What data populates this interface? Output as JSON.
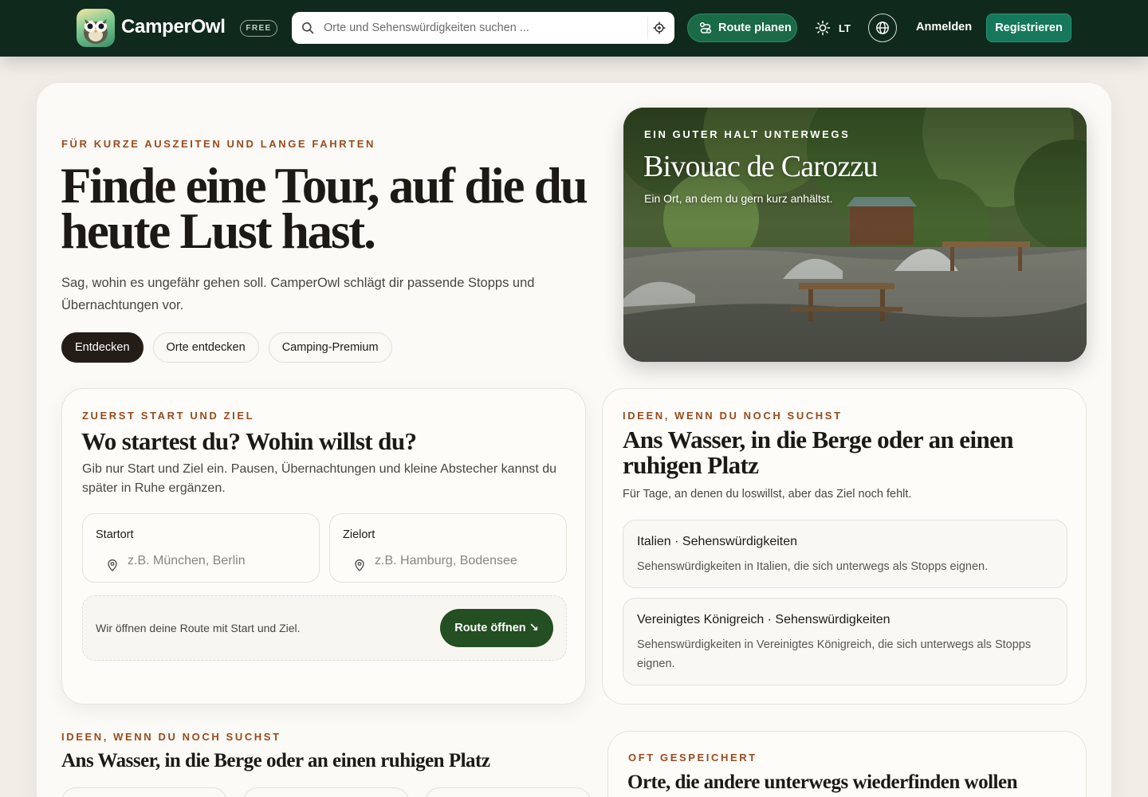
{
  "header": {
    "brand": "CamperOwl",
    "badge": "FREE",
    "search_placeholder": "Orte und Sehenswürdigkeiten suchen ...",
    "route_button": "Route planen",
    "theme_label": "LT",
    "login": "Anmelden",
    "register": "Registrieren",
    "icons": [
      "owl-logo",
      "search-icon",
      "locate-icon",
      "route-icon",
      "sun-icon",
      "globe-icon"
    ]
  },
  "hero": {
    "eyebrow": "FÜR KURZE AUSZEITEN UND LANGE FAHRTEN",
    "title": "Finde eine Tour, auf die du heute Lust hast.",
    "subtitle": "Sag, wohin es ungefähr gehen soll. CamperOwl schlägt dir passende Stopps und Übernachtungen vor.",
    "tabs": [
      {
        "label": "Entdecken",
        "active": true
      },
      {
        "label": "Orte entdecken",
        "active": false
      },
      {
        "label": "Camping-Premium",
        "active": false
      }
    ]
  },
  "featured": {
    "eyebrow": "EIN GUTER HALT UNTERWEGS",
    "title": "Bivouac de Carozzu",
    "subtitle": "Ein Ort, an dem du gern kurz anhältst."
  },
  "route_planner": {
    "eyebrow": "ZUERST START UND ZIEL",
    "title": "Wo startest du? Wohin willst du?",
    "subtitle": "Gib nur Start und Ziel ein. Pausen, Übernachtungen und kleine Abstecher kannst du später in Ruhe ergänzen.",
    "start_label": "Startort",
    "start_placeholder": "z.B. München, Berlin",
    "end_label": "Zielort",
    "end_placeholder": "z.B. Hamburg, Bodensee",
    "note": "Wir öffnen deine Route mit Start und Ziel.",
    "submit": "Route öffnen",
    "submit_icon": "↘"
  },
  "ideas": {
    "eyebrow": "IDEEN, WENN DU NOCH SUCHST",
    "title": "Ans Wasser, in die Berge oder an einen ruhigen Platz",
    "subtitle": "Für Tage, an denen du loswillst, aber das Ziel noch fehlt.",
    "items": [
      {
        "title": "Italien · Sehenswürdigkeiten",
        "desc": "Sehenswürdigkeiten in Italien, die sich unterwegs als Stopps eignen."
      },
      {
        "title": "Vereinigtes Königreich · Sehenswürdigkeiten",
        "desc": "Sehenswürdigkeiten in Vereinigtes Königreich, die sich unterwegs als Stopps eignen."
      }
    ]
  },
  "bottom_ideas": {
    "eyebrow": "IDEEN, WENN DU NOCH SUCHST",
    "title": "Ans Wasser, in die Berge oder an einen ruhigen Platz"
  },
  "saved": {
    "eyebrow": "OFT GESPEICHERT",
    "title": "Orte, die andere unterwegs wiederfinden wollen"
  },
  "colors": {
    "topbar": "#0f2a1d",
    "accent_green": "#1a6a48",
    "button_dark_green": "#234f22",
    "eyebrow": "#9a4a1d",
    "active_pill": "#241c17"
  }
}
